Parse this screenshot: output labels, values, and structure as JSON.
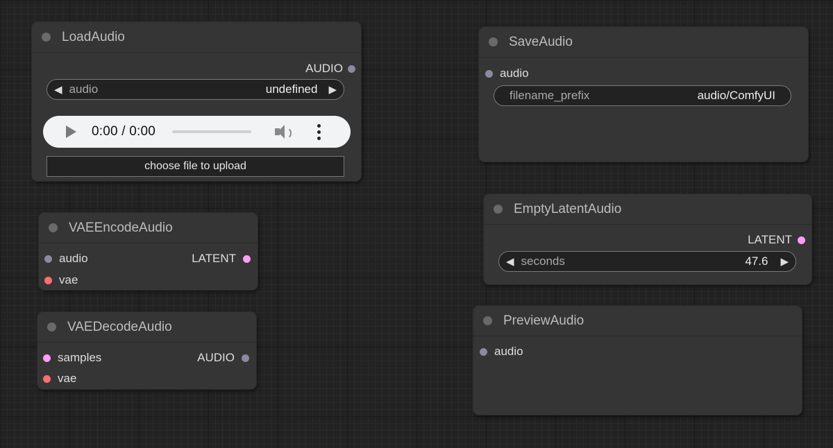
{
  "colors": {
    "audio_slot": "#8a8aa0",
    "latent_slot": "#ff9cf9",
    "vae_slot": "#ff6e6e",
    "samples_slot": "#ff9cf9"
  },
  "load_audio": {
    "title": "LoadAudio",
    "output_label": "AUDIO",
    "combo": {
      "label": "audio",
      "value": "undefined"
    },
    "player": {
      "time": "0:00 / 0:00"
    },
    "upload_label": "choose file to upload"
  },
  "vae_encode": {
    "title": "VAEEncodeAudio",
    "inputs": [
      "audio",
      "vae"
    ],
    "output_label": "LATENT"
  },
  "vae_decode": {
    "title": "VAEDecodeAudio",
    "inputs": [
      "samples",
      "vae"
    ],
    "output_label": "AUDIO"
  },
  "save_audio": {
    "title": "SaveAudio",
    "input_label": "audio",
    "text_widget": {
      "label": "filename_prefix",
      "value": "audio/ComfyUI"
    }
  },
  "empty_latent": {
    "title": "EmptyLatentAudio",
    "output_label": "LATENT",
    "number_widget": {
      "label": "seconds",
      "value": "47.6"
    }
  },
  "preview_audio": {
    "title": "PreviewAudio",
    "input_label": "audio"
  }
}
